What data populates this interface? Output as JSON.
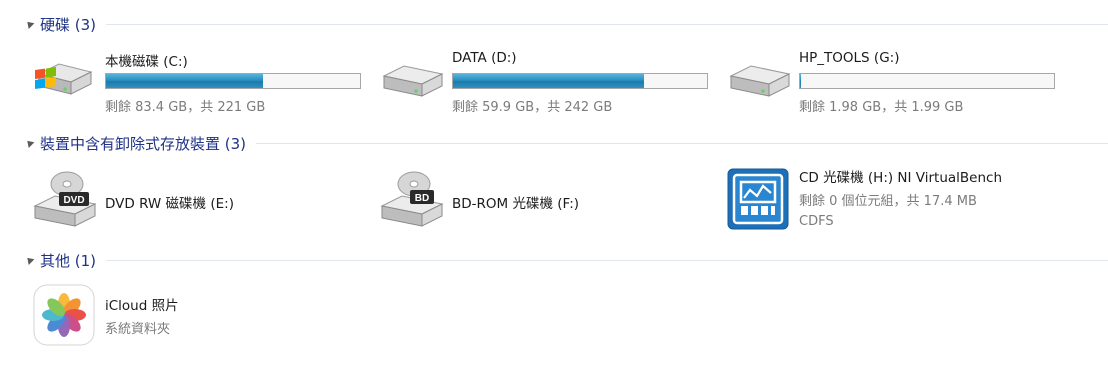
{
  "groups": {
    "hard_disks": {
      "title": "硬碟 (3)"
    },
    "removable": {
      "title": "裝置中含有卸除式存放裝置 (3)"
    },
    "other": {
      "title": "其他 (1)"
    }
  },
  "drives": [
    {
      "name": "本機磁碟 (C:)",
      "space": "剩餘 83.4 GB，共 221 GB",
      "used_fraction": 0.62,
      "icon": "windows-drive-icon"
    },
    {
      "name": "DATA (D:)",
      "space": "剩餘 59.9 GB，共 242 GB",
      "used_fraction": 0.75,
      "icon": "hard-drive-icon"
    },
    {
      "name": "HP_TOOLS (G:)",
      "space": "剩餘 1.98 GB，共 1.99 GB",
      "used_fraction": 0.005,
      "icon": "hard-drive-icon"
    }
  ],
  "removable": [
    {
      "name": "DVD RW 磁碟機 (E:)",
      "icon": "dvd-drive-icon",
      "badge": "DVD"
    },
    {
      "name": "BD-ROM 光碟機 (F:)",
      "icon": "bd-drive-icon",
      "badge": "BD"
    },
    {
      "name": "CD 光碟機 (H:) NI VirtualBench",
      "space": "剩餘 0 個位元組，共 17.4 MB",
      "fs": "CDFS",
      "icon": "virtualbench-icon"
    }
  ],
  "other": [
    {
      "name": "iCloud 照片",
      "type": "系統資料夾",
      "icon": "icloud-photos-icon"
    }
  ],
  "colors": {
    "group_title": "#1e3287",
    "bar_fill": "#2a8ec0",
    "subtext": "#7b7b7b"
  }
}
